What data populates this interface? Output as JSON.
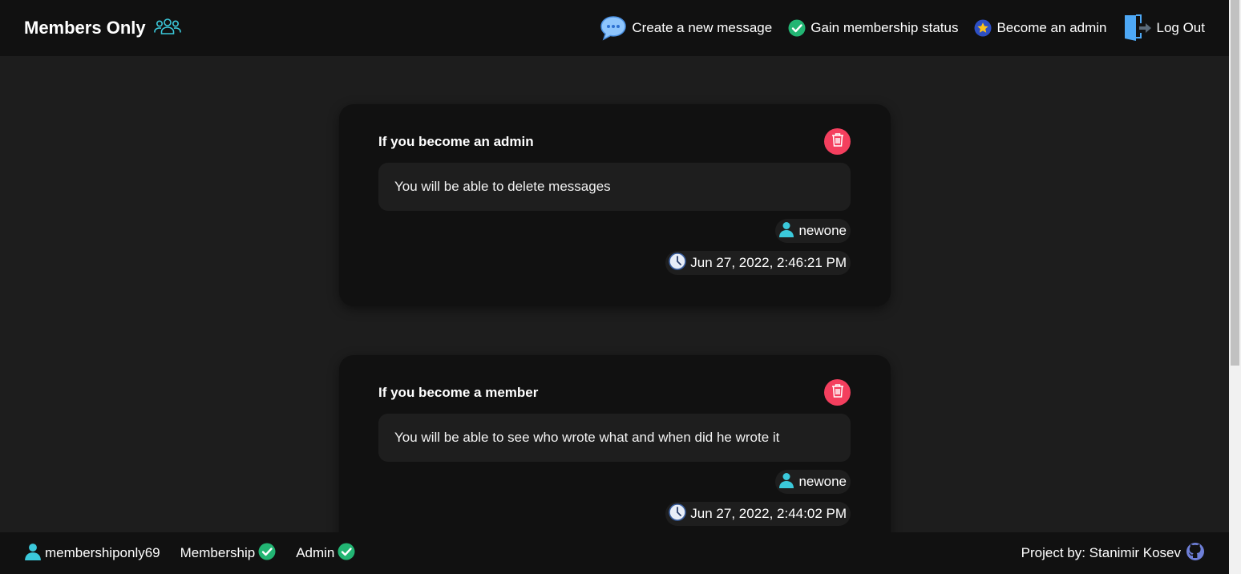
{
  "header": {
    "brand": "Members Only",
    "nav": {
      "create_message": "Create a new message",
      "gain_membership": "Gain membership status",
      "become_admin": "Become an admin",
      "log_out": "Log Out"
    }
  },
  "messages": [
    {
      "title": "If you become an admin",
      "body": "You will be able to delete messages",
      "author": "newone",
      "timestamp": "Jun 27, 2022, 2:46:21 PM"
    },
    {
      "title": "If you become a member",
      "body": "You will be able to see who wrote what and when did he wrote it",
      "author": "newone",
      "timestamp": "Jun 27, 2022, 2:44:02 PM"
    }
  ],
  "footer": {
    "username": "membershiponly69",
    "membership_label": "Membership",
    "admin_label": "Admin",
    "credit": "Project by: Stanimir Kosev"
  },
  "colors": {
    "accent_teal": "#3bc9db",
    "check_green": "#22b573",
    "delete_red": "#f43f5e",
    "header_bg": "#111111",
    "page_bg": "#1d1d1d"
  }
}
